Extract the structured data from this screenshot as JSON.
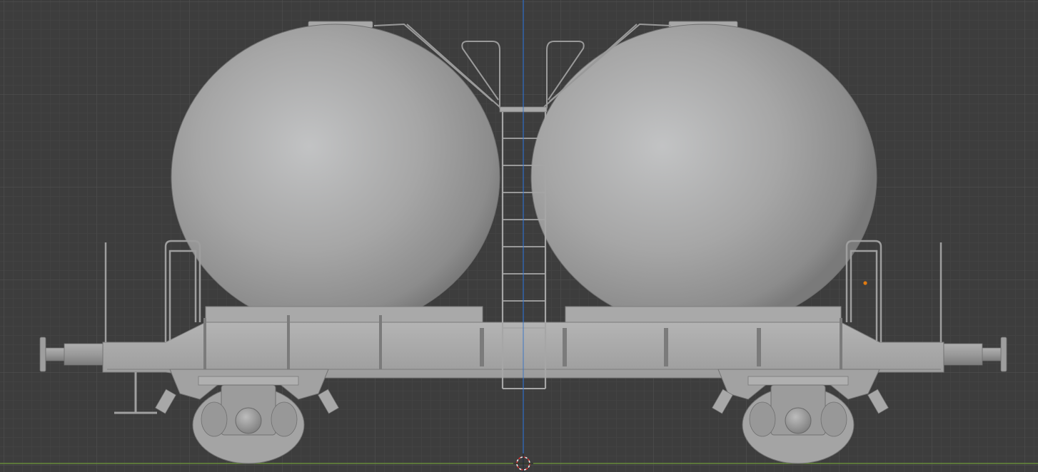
{
  "viewport": {
    "mode": "orthographic-front",
    "background": "#3d3d3d",
    "grid_minor_color": "#444444",
    "grid_major_color": "#4b4b4b",
    "z_axis_color": "#2f6fc8",
    "x_axis_color": "#6f9a3a",
    "origin_color": "#d43030",
    "selection_dot_color": "#e07a10"
  },
  "object": {
    "name": "",
    "shade_color": "#a8a8a8",
    "parts": [
      "left-sphere-tank",
      "right-sphere-tank",
      "center-ladder",
      "frame",
      "left-bogie",
      "right-bogie",
      "left-buffer",
      "right-buffer"
    ]
  }
}
